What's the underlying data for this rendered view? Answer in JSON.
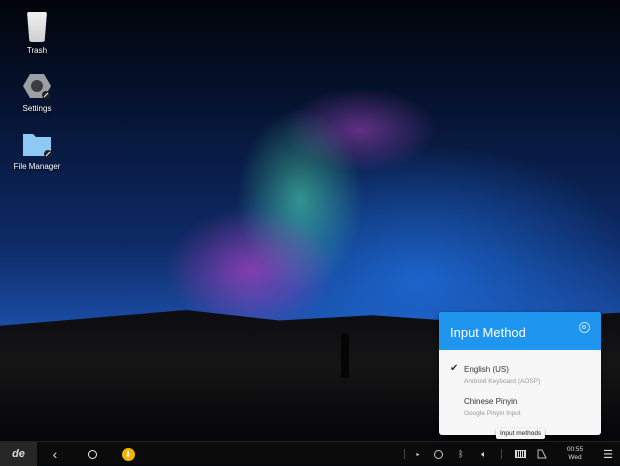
{
  "desktop": {
    "icons": [
      {
        "label": "Trash",
        "icon": "trash-icon"
      },
      {
        "label": "Settings",
        "icon": "settings-icon"
      },
      {
        "label": "File Manager",
        "icon": "folder-icon"
      }
    ]
  },
  "popup": {
    "title": "Input Method",
    "items": [
      {
        "name": "English (US)",
        "sub": "Android Keyboard (AOSP)",
        "checked": true
      },
      {
        "name": "Chinese Pinyin",
        "sub": "Google Pinyin Input",
        "checked": false
      }
    ]
  },
  "tooltip": "Input methods",
  "taskbar": {
    "logo": "de",
    "time": "00:55",
    "day": "Wed"
  },
  "colors": {
    "accent": "#1e96f0",
    "notification": "#f5b301"
  }
}
